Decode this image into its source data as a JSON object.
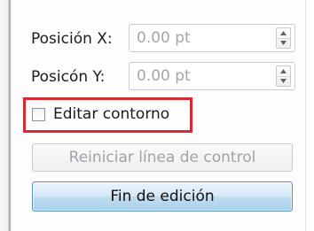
{
  "fields": [
    {
      "label": "Posición X:",
      "value": "0.00 pt"
    },
    {
      "label": "Posicón Y:",
      "value": "0.00 pt"
    }
  ],
  "checkbox": {
    "label": "Editar contorno",
    "checked": false
  },
  "buttons": {
    "reset_label": "Reiniciar línea de control",
    "finish_label": "Fin de edición"
  },
  "colors": {
    "highlight": "#d62b32",
    "primary_button": "#c0ddf2",
    "disabled_text": "#9ea3a9"
  }
}
